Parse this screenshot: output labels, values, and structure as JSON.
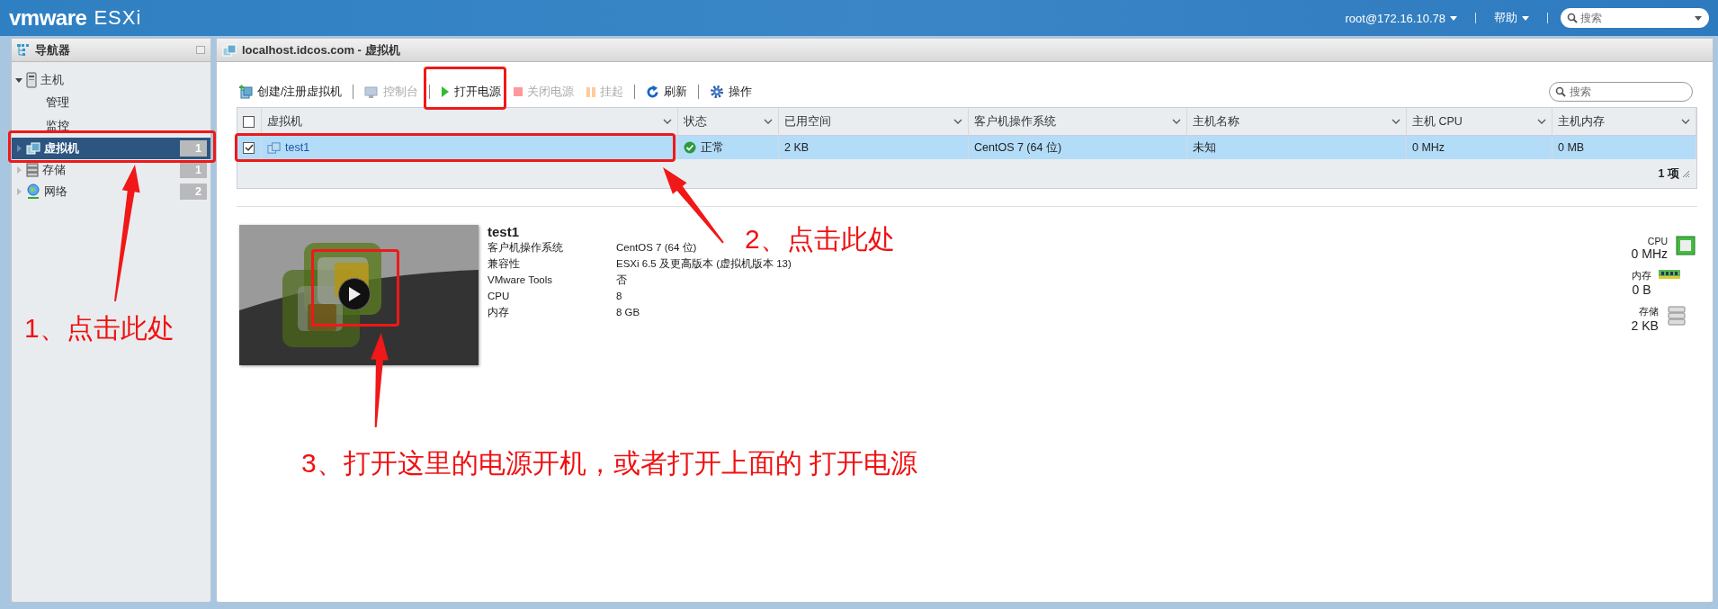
{
  "topbar": {
    "logo": "vmware",
    "product": "ESXi",
    "user": "root@172.16.10.78",
    "help": "帮助",
    "search_placeholder": "搜索"
  },
  "navigator": {
    "title": "导航器",
    "items": [
      {
        "label": "主机",
        "kind": "host",
        "expanded": true,
        "selected": false,
        "children": [
          {
            "label": "管理",
            "selected": false
          },
          {
            "label": "监控",
            "selected": false
          }
        ]
      },
      {
        "label": "虚拟机",
        "kind": "vm",
        "expanded": false,
        "selected": true,
        "count": "1"
      },
      {
        "label": "存储",
        "kind": "storage",
        "expanded": false,
        "selected": false,
        "count": "1"
      },
      {
        "label": "网络",
        "kind": "network",
        "expanded": false,
        "selected": false,
        "count": "2"
      }
    ]
  },
  "main": {
    "title": "localhost.idcos.com - 虚拟机",
    "toolbar": [
      {
        "label": "创建/注册虚拟机",
        "kind": "create",
        "disabled": false
      },
      {
        "label": "控制台",
        "kind": "console",
        "disabled": true
      },
      {
        "label": "打开电源",
        "kind": "power-on",
        "disabled": false
      },
      {
        "label": "关闭电源",
        "kind": "power-off",
        "disabled": true
      },
      {
        "label": "挂起",
        "kind": "suspend",
        "disabled": true
      },
      {
        "label": "刷新",
        "kind": "refresh",
        "disabled": false
      },
      {
        "label": "操作",
        "kind": "actions",
        "disabled": false
      }
    ],
    "search_placeholder": "搜索",
    "table": {
      "header_checked": false,
      "columns": [
        "虚拟机",
        "状态",
        "已用空间",
        "客户机操作系统",
        "主机名称",
        "主机 CPU",
        "主机内存"
      ],
      "rows": [
        {
          "selected": true,
          "checked": true,
          "cells": [
            "test1",
            "正常",
            "2 KB",
            "CentOS 7 (64 位)",
            "未知",
            "0 MHz",
            "0 MB"
          ]
        }
      ],
      "footer": "1 项"
    },
    "detail": {
      "name": "test1",
      "properties": [
        {
          "label": "客户机操作系统",
          "value": "CentOS 7 (64 位)"
        },
        {
          "label": "兼容性",
          "value": "ESXi 6.5 及更高版本 (虚拟机版本 13)"
        },
        {
          "label": "VMware Tools",
          "value": "否"
        },
        {
          "label": "CPU",
          "value": "8"
        },
        {
          "label": "内存",
          "value": "8 GB"
        }
      ],
      "stats": [
        {
          "label": "CPU",
          "value": "0 MHz",
          "kind": "cpu"
        },
        {
          "label": "内存",
          "value": "0 B",
          "kind": "memory"
        },
        {
          "label": "存储",
          "value": "2 KB",
          "kind": "storage"
        }
      ]
    }
  },
  "annotations": [
    {
      "text": "1、点击此处"
    },
    {
      "text": "2、点击此处"
    },
    {
      "text": "3、打开这里的电源开机，或者打开上面的 打开电源"
    }
  ]
}
